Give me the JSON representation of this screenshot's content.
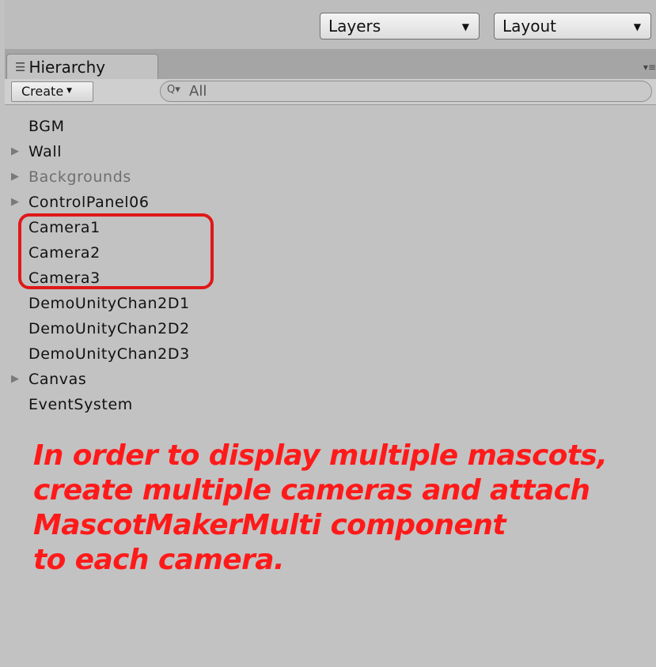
{
  "toolbar": {
    "layers_label": "Layers",
    "layout_label": "Layout"
  },
  "tab": {
    "label": "Hierarchy",
    "icon": "hierarchy-list-icon"
  },
  "create_label": "Create",
  "search": {
    "placeholder": "All",
    "icon": "search-icon"
  },
  "hierarchy": [
    {
      "label": "BGM",
      "expandable": false,
      "dim": false
    },
    {
      "label": "Wall",
      "expandable": true,
      "dim": false
    },
    {
      "label": "Backgrounds",
      "expandable": true,
      "dim": true
    },
    {
      "label": "ControlPanel06",
      "expandable": true,
      "dim": false
    },
    {
      "label": "Camera1",
      "expandable": false,
      "dim": false
    },
    {
      "label": "Camera2",
      "expandable": false,
      "dim": false
    },
    {
      "label": "Camera3",
      "expandable": false,
      "dim": false
    },
    {
      "label": "DemoUnityChan2D1",
      "expandable": false,
      "dim": false
    },
    {
      "label": "DemoUnityChan2D2",
      "expandable": false,
      "dim": false
    },
    {
      "label": "DemoUnityChan2D3",
      "expandable": false,
      "dim": false
    },
    {
      "label": "Canvas",
      "expandable": true,
      "dim": false
    },
    {
      "label": "EventSystem",
      "expandable": false,
      "dim": false
    }
  ],
  "annotation": {
    "lines": [
      "In order to display multiple mascots,",
      "create multiple cameras and attach",
      "MascotMakerMulti component",
      "to each camera."
    ],
    "color": "#ff1a1a"
  },
  "highlight_color": "#e01818"
}
